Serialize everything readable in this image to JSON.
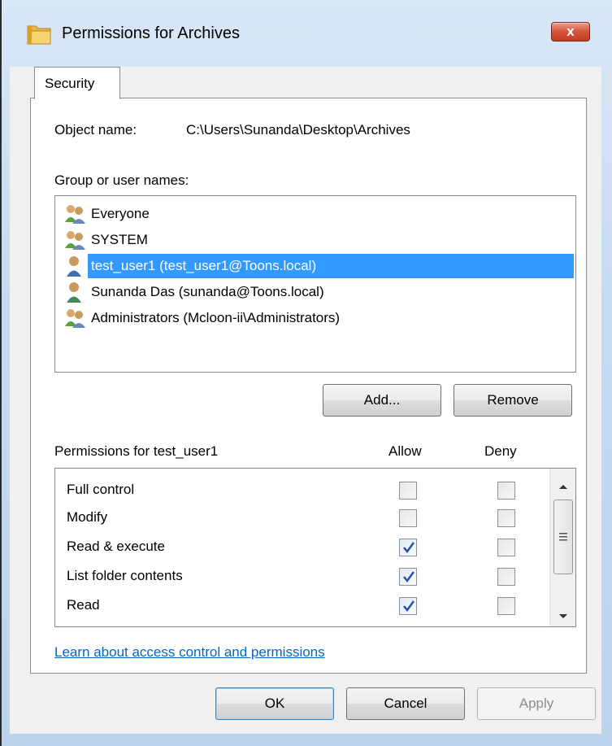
{
  "window": {
    "title": "Permissions for Archives",
    "close_label": "x"
  },
  "tabs": [
    {
      "label": "Security",
      "selected": true
    }
  ],
  "object": {
    "label": "Object name:",
    "value": "C:\\Users\\Sunanda\\Desktop\\Archives"
  },
  "groups": {
    "label": "Group or user names:",
    "items": [
      {
        "name": "Everyone",
        "icon": "group-users-icon",
        "selected": false
      },
      {
        "name": "SYSTEM",
        "icon": "group-users-icon",
        "selected": false
      },
      {
        "name": "test_user1 (test_user1@Toons.local)",
        "icon": "single-user-icon",
        "selected": true
      },
      {
        "name": "Sunanda Das (sunanda@Toons.local)",
        "icon": "single-user-icon",
        "selected": false
      },
      {
        "name": "Administrators (Mcloon-ii\\Administrators)",
        "icon": "group-users-icon",
        "selected": false
      }
    ]
  },
  "buttons": {
    "add": "Add...",
    "remove": "Remove",
    "ok": "OK",
    "cancel": "Cancel",
    "apply": "Apply"
  },
  "permissions": {
    "label": "Permissions for test_user1",
    "allow_header": "Allow",
    "deny_header": "Deny",
    "rows": [
      {
        "name": "Full control",
        "allow": false,
        "deny": false
      },
      {
        "name": "Modify",
        "allow": false,
        "deny": false
      },
      {
        "name": "Read & execute",
        "allow": true,
        "deny": false
      },
      {
        "name": "List folder contents",
        "allow": true,
        "deny": false
      },
      {
        "name": "Read",
        "allow": true,
        "deny": false
      }
    ]
  },
  "link": {
    "text": "Learn about access control and permissions"
  },
  "colors": {
    "selection": "#3399ff",
    "link": "#0066cc",
    "close_button": "#c23d22"
  }
}
